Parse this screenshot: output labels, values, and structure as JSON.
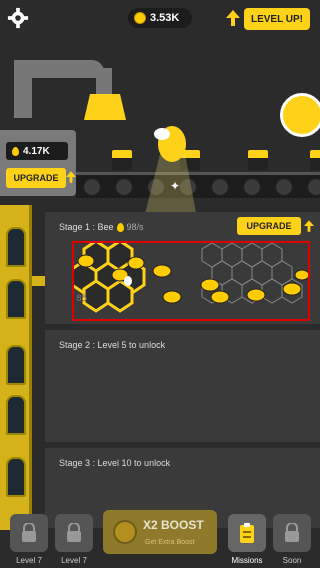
{
  "topbar": {
    "coins": "3.53K",
    "level_up": "LEVEL UP!"
  },
  "storage": {
    "honey": "4.17K",
    "upgrade": "UPGRADE"
  },
  "stages": [
    {
      "label": "Stage 1 : Bee",
      "rate": "98/s",
      "upgrade": "UPGRADE",
      "cell_count": "85"
    },
    {
      "label": "Stage 2 : Level 5 to unlock"
    },
    {
      "label": "Stage 3 : Level 10 to unlock"
    }
  ],
  "bottom": {
    "left1": "Level 7",
    "left2": "Level 7",
    "boost_title": "X2 BOOST",
    "boost_sub": "Get Extra Boost",
    "missions": "Missions",
    "soon": "Soon"
  },
  "colors": {
    "accent": "#ffd21a",
    "highlight_box": "#e10000"
  }
}
